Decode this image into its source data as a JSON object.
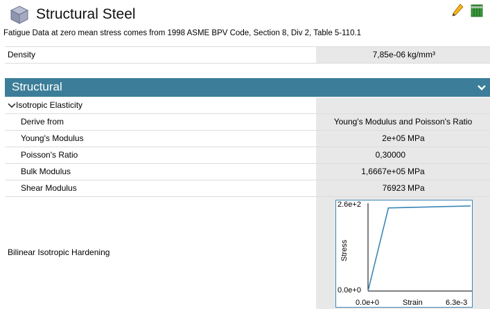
{
  "header": {
    "title": "Structural Steel",
    "icons": [
      "material-cube-icon",
      "pencil-icon",
      "library-icon"
    ]
  },
  "description": "Fatigue Data at zero mean stress comes from 1998 ASME BPV Code, Section 8, Div 2, Table 5-110.1",
  "density": {
    "label": "Density",
    "value": "7,85e-06",
    "unit": "kg/mm³"
  },
  "structural": {
    "title": "Structural",
    "group": "Isotropic Elasticity",
    "rows": [
      {
        "label": "Derive from",
        "value": "Young's Modulus and Poisson's Ratio",
        "unit": ""
      },
      {
        "label": "Young's Modulus",
        "value": "2e+05",
        "unit": "MPa"
      },
      {
        "label": "Poisson's Ratio",
        "value": "0,30000",
        "unit": ""
      },
      {
        "label": "Bulk Modulus",
        "value": "1,6667e+05",
        "unit": "MPa"
      },
      {
        "label": "Shear Modulus",
        "value": "76923",
        "unit": "MPa"
      }
    ],
    "hardening_label": "Bilinear Isotropic Hardening"
  },
  "colors": {
    "section_bar": "#3c7e99",
    "value_bg": "#e8e8e8",
    "chart_line": "#3a86b6"
  },
  "chart_data": {
    "type": "line",
    "xlabel": "Strain",
    "ylabel": "Stress",
    "x_tick_labels": [
      "0.0e+0",
      "6.3e-3"
    ],
    "y_tick_labels": [
      "0.0e+0",
      "2.6e+2"
    ],
    "xlim": [
      0,
      0.0063
    ],
    "ylim": [
      0,
      260
    ],
    "series": [
      {
        "x": [
          0,
          0.00125,
          0.0063
        ],
        "y": [
          0,
          250,
          256
        ]
      }
    ]
  }
}
